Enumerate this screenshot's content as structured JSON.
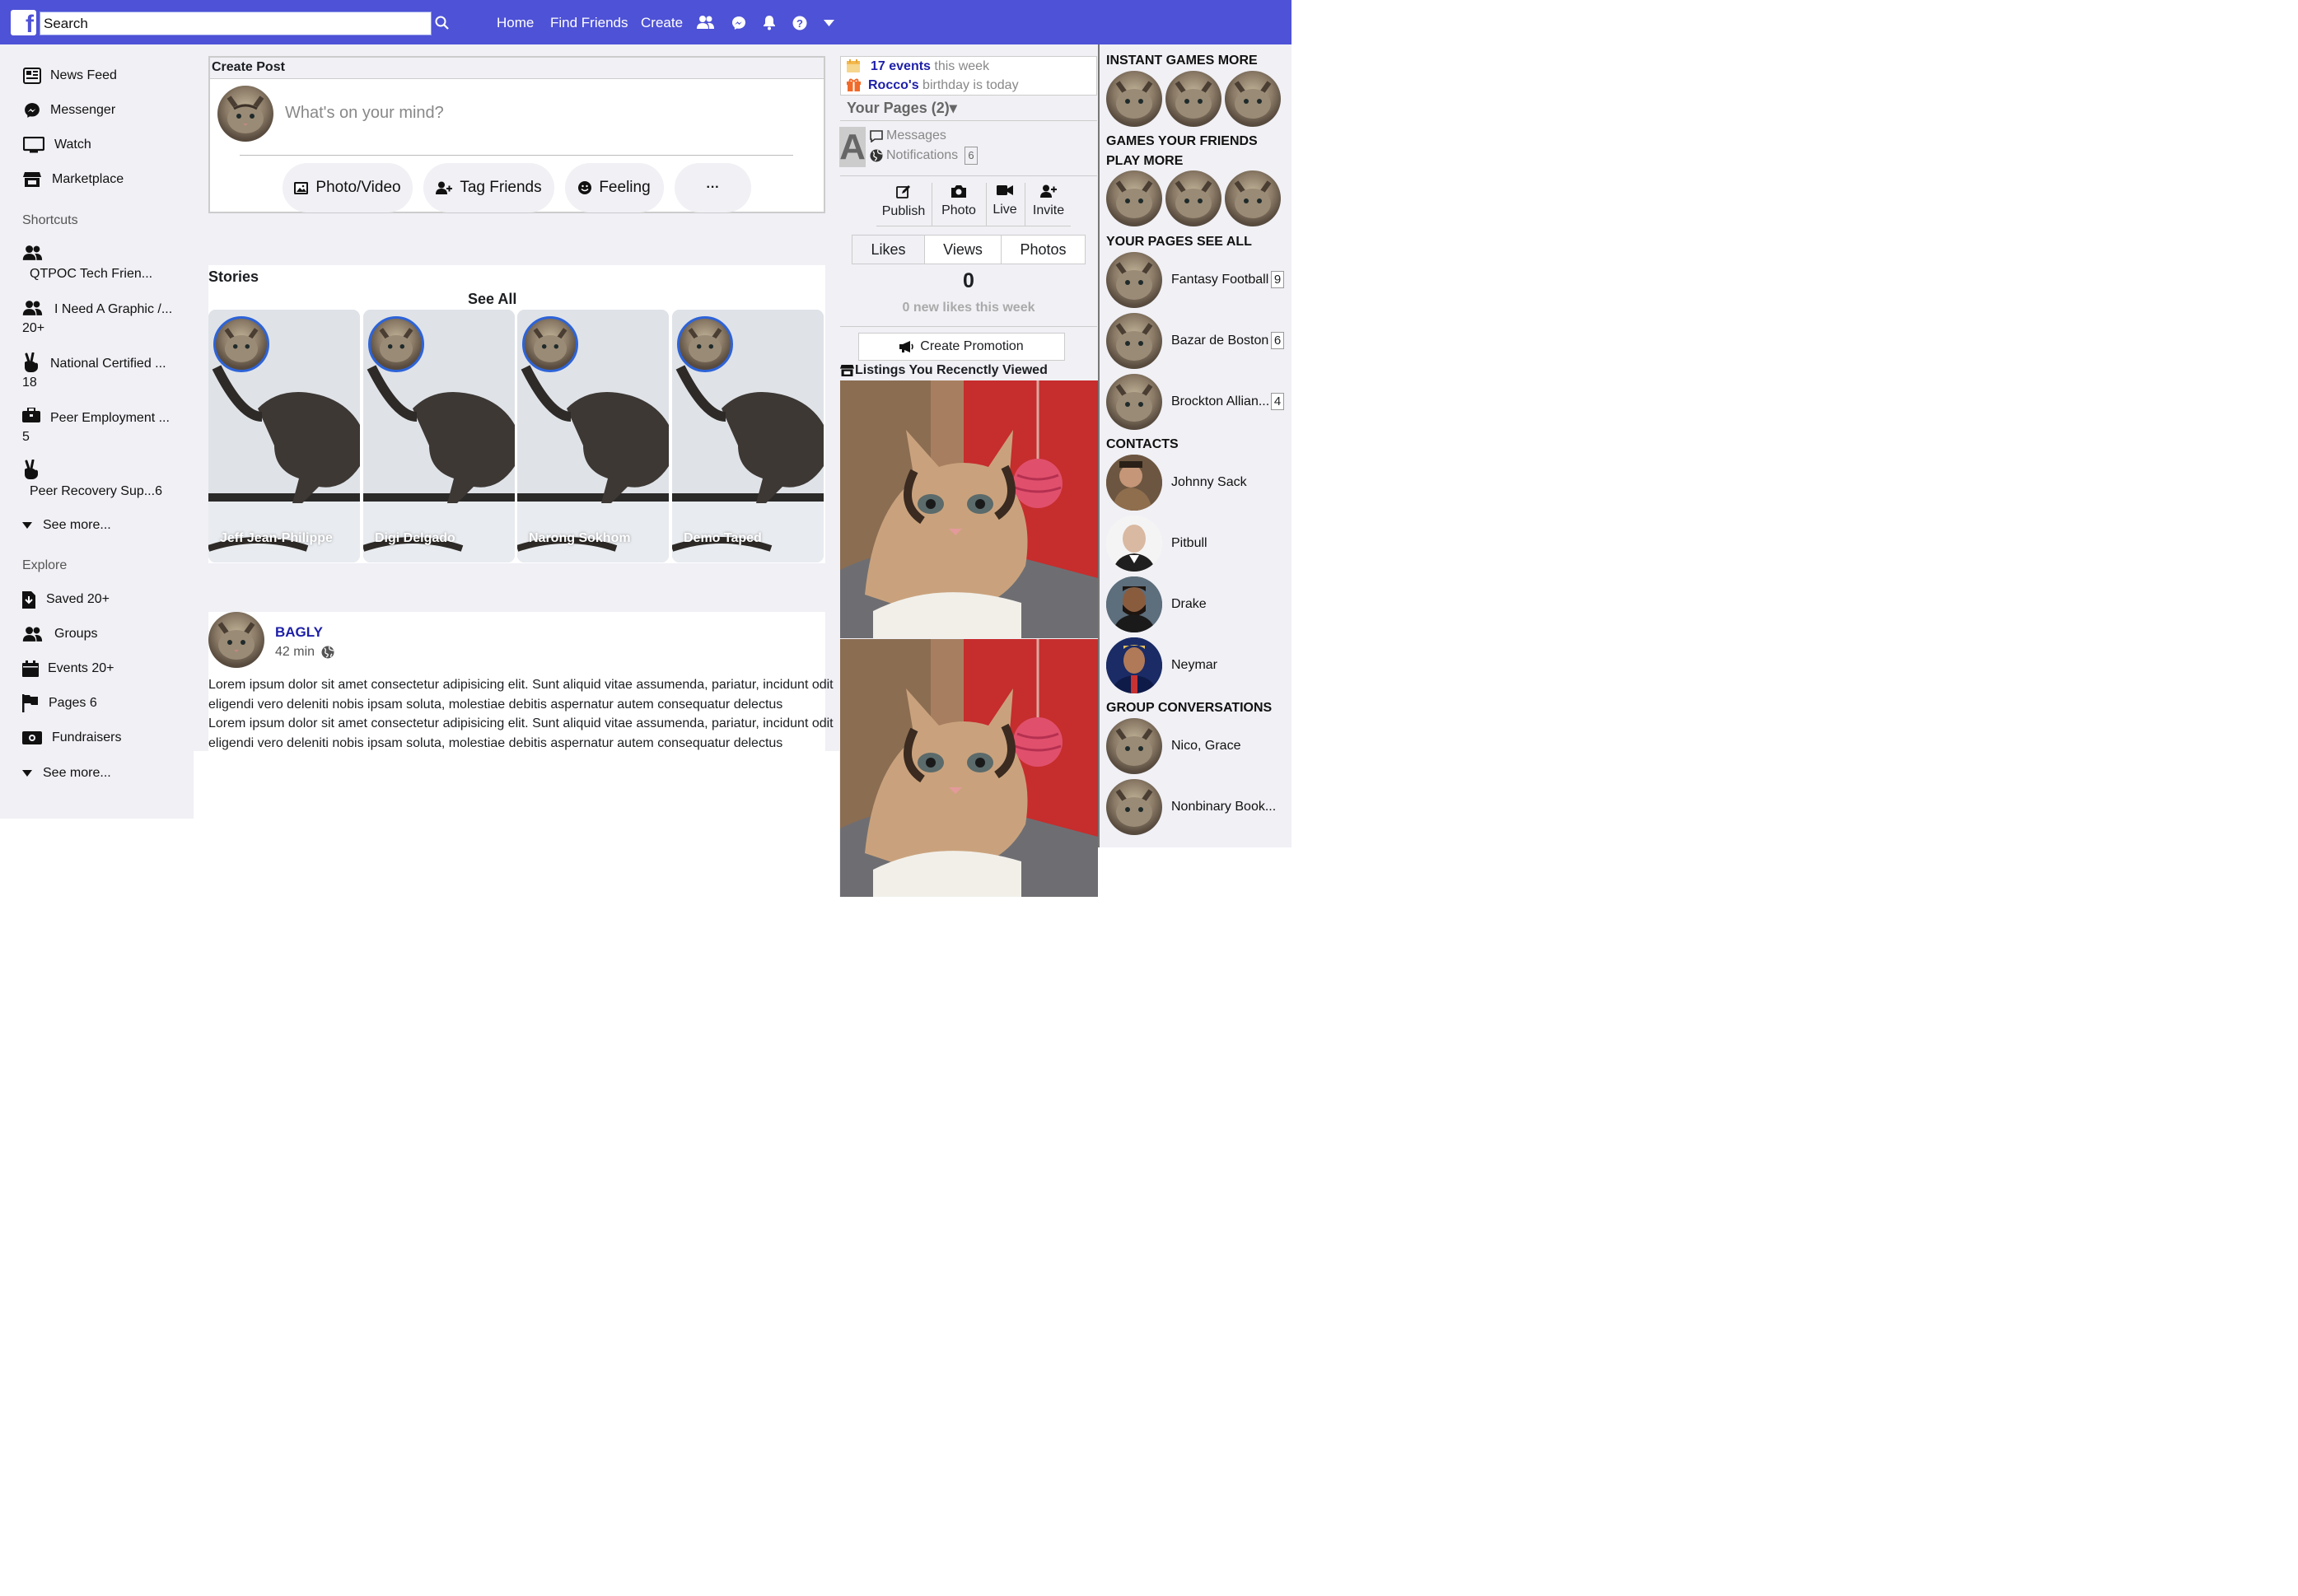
{
  "topbar": {
    "logo": "f",
    "search_placeholder": "Search",
    "nav": [
      "Home",
      "Find Friends",
      "Create"
    ],
    "accent": "#4e52d6"
  },
  "left": {
    "main": [
      "News Feed",
      "Messenger",
      "Watch",
      "Marketplace"
    ],
    "shortcuts_title": "Shortcuts",
    "shortcuts": [
      {
        "label": "QTPOC Tech Frien..."
      },
      {
        "label": "I Need A Graphic /...",
        "count": "20+"
      },
      {
        "label": "National Certified ...",
        "count": "18"
      },
      {
        "label": "Peer Employment ...",
        "count": "5"
      },
      {
        "label": "Peer Recovery Sup...6"
      }
    ],
    "see_more_1": "See more...",
    "explore_title": "Explore",
    "explore": [
      "Saved 20+",
      "Groups",
      "Events 20+",
      "Pages 6",
      "Fundraisers"
    ],
    "see_more_2": "See more..."
  },
  "create_post": {
    "title": "Create Post",
    "placeholder": "What's on your mind?",
    "actions": [
      "Photo/Video",
      "Tag Friends",
      "Feeling",
      "···"
    ]
  },
  "stories": {
    "title": "Stories",
    "see_all": "See All",
    "names": [
      "Jeff Jean-Philippe",
      "Digi Delgado",
      "Narong Sokhom",
      "Demo Taped"
    ]
  },
  "post": {
    "author": "BAGLY",
    "time": "42 min",
    "lines": [
      "Lorem ipsum dolor sit amet consectetur adipisicing elit. Sunt aliquid vitae assumenda, pariatur, incidunt odit",
      "eligendi vero deleniti nobis ipsam soluta, molestiae debitis aspernatur autem consequatur delectus",
      "Lorem ipsum dolor sit amet consectetur adipisicing elit. Sunt aliquid vitae assumenda, pariatur, incidunt odit",
      "eligendi vero deleniti nobis ipsam soluta, molestiae debitis aspernatur autem consequatur delectus"
    ]
  },
  "right": {
    "events_count": "17 events",
    "events_suffix": " this week",
    "birthday_name": "Rocco's",
    "birthday_suffix": " birthday is today",
    "your_pages": "Your Pages (2)▾",
    "page_initial": "A",
    "messages": "Messages",
    "notifications": "Notifications",
    "notif_count": "6",
    "page_actions": [
      "Publish",
      "Photo",
      "Live",
      "Invite"
    ],
    "tabs": [
      "Likes",
      "Views",
      "Photos"
    ],
    "likes_value": "0",
    "likes_sub": "0 new likes this week",
    "promotion": "Create Promotion",
    "listings_title": "Listings You Recenctly Viewed"
  },
  "far_right": {
    "instant_games": "INSTANT GAMES MORE",
    "friends_games_1": "GAMES YOUR FRIENDS",
    "friends_games_2": "PLAY MORE",
    "your_pages": "YOUR PAGES SEE ALL",
    "pages": [
      {
        "name": "Fantasy Football",
        "count": "9"
      },
      {
        "name": "Bazar de Boston",
        "count": "6"
      },
      {
        "name": "Brockton Allian...",
        "count": "4"
      }
    ],
    "contacts_title": "CONTACTS",
    "contacts": [
      "Johnny Sack",
      "Pitbull",
      "Drake",
      "Neymar"
    ],
    "group_title": "GROUP CONVERSATIONS",
    "groups": [
      "Nico, Grace",
      "Nonbinary Book..."
    ]
  }
}
